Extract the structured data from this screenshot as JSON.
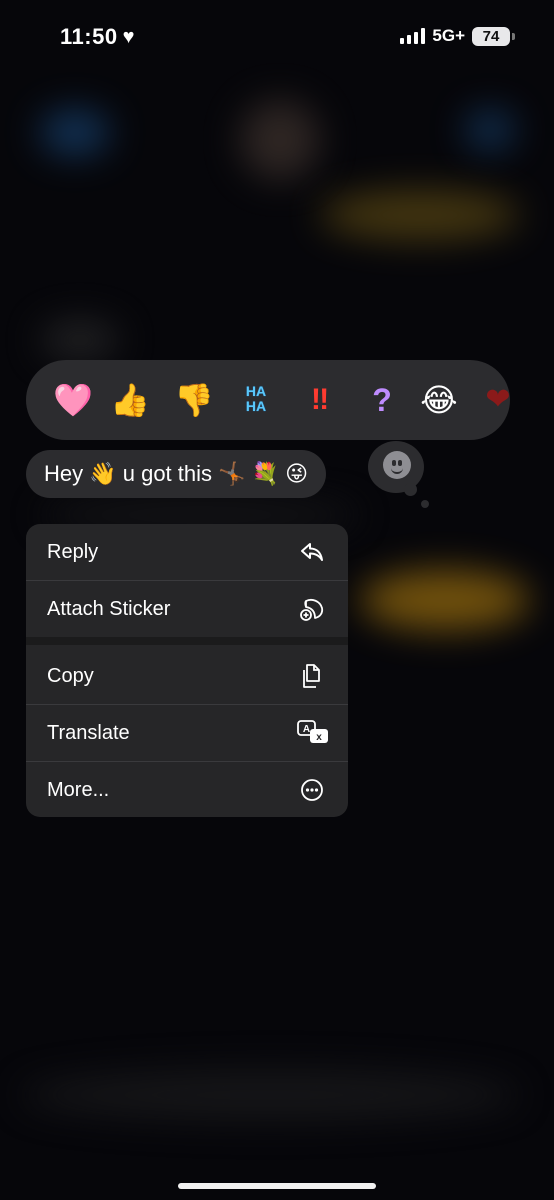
{
  "status_bar": {
    "time": "11:50",
    "network": "5G+",
    "battery": "74"
  },
  "reactions": [
    {
      "name": "heart",
      "glyph": "🩷"
    },
    {
      "name": "thumbs-up",
      "glyph": "👍"
    },
    {
      "name": "thumbs-down",
      "glyph": "👎"
    },
    {
      "name": "haha",
      "glyph": "HA\nHA"
    },
    {
      "name": "emphasize",
      "glyph": "‼"
    },
    {
      "name": "question",
      "glyph": "?"
    },
    {
      "name": "laughing",
      "glyph": "😂"
    }
  ],
  "message": {
    "text": "Hey 👋 u got this 🤸🏾 💐 😜"
  },
  "menu": {
    "reply": "Reply",
    "attach_sticker": "Attach Sticker",
    "copy": "Copy",
    "translate": "Translate",
    "more": "More..."
  }
}
